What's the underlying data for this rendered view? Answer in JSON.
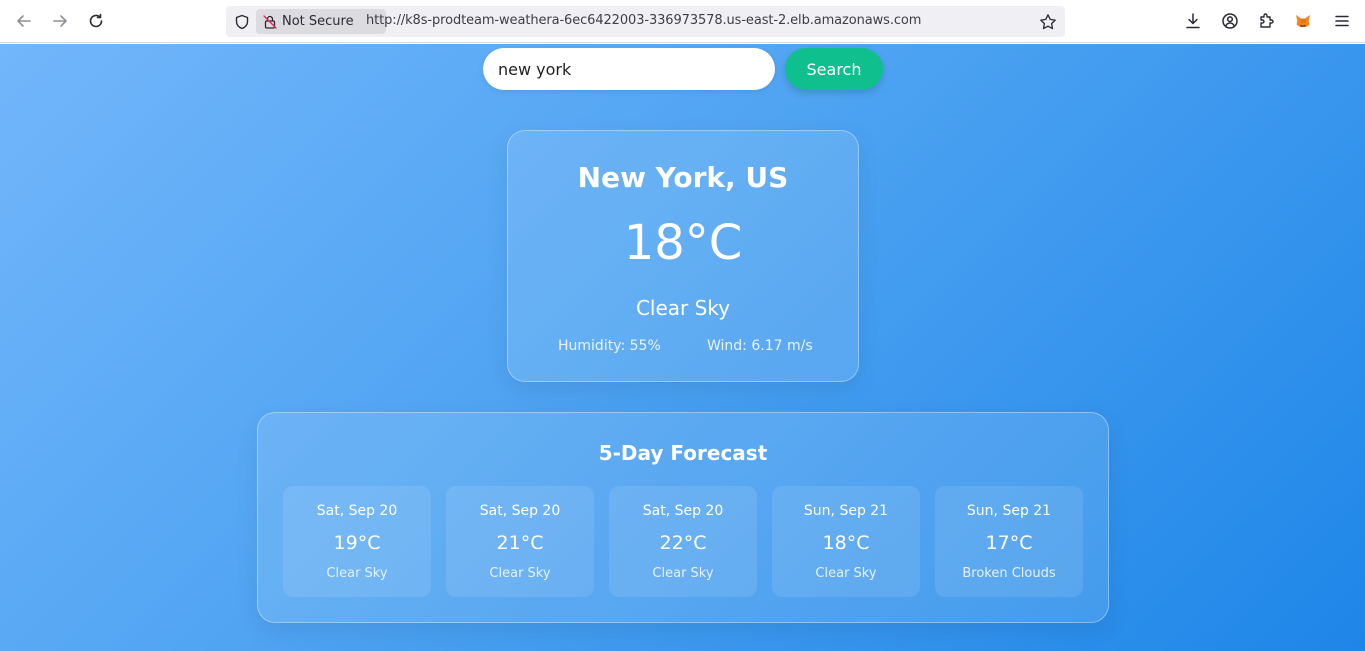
{
  "browser": {
    "security_label": "Not Secure",
    "url": "http://k8s-prodteam-weathera-6ec6422003-336973578.us-east-2.elb.amazonaws.com"
  },
  "search": {
    "value": "new york",
    "button_label": "Search"
  },
  "current": {
    "city": "New York, US",
    "temperature": "18°C",
    "description": "Clear Sky",
    "humidity": "Humidity: 55%",
    "wind": "Wind: 6.17 m/s"
  },
  "forecast": {
    "title": "5-Day Forecast",
    "days": [
      {
        "date": "Sat, Sep 20",
        "temp": "19°C",
        "desc": "Clear Sky"
      },
      {
        "date": "Sat, Sep 20",
        "temp": "21°C",
        "desc": "Clear Sky"
      },
      {
        "date": "Sat, Sep 20",
        "temp": "22°C",
        "desc": "Clear Sky"
      },
      {
        "date": "Sun, Sep 21",
        "temp": "18°C",
        "desc": "Clear Sky"
      },
      {
        "date": "Sun, Sep 21",
        "temp": "17°C",
        "desc": "Broken Clouds"
      }
    ]
  },
  "icons": {
    "back": "arrow-left-icon",
    "forward": "arrow-right-icon",
    "reload": "reload-icon",
    "shield": "shield-icon",
    "insecure_lock": "insecure-lock-icon",
    "bookmark": "star-icon",
    "downloads": "download-icon",
    "account": "account-icon",
    "extensions": "puzzle-icon",
    "metamask": "fox-icon",
    "menu": "hamburger-menu-icon"
  },
  "colors": {
    "search_button": "#0fbf8d",
    "background_start": "#72b6fb",
    "background_end": "#1e86e8"
  }
}
